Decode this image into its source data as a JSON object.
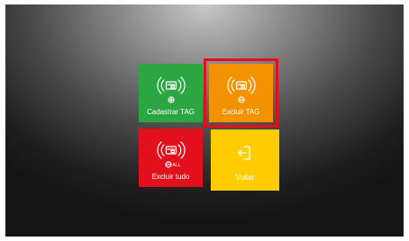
{
  "tiles": {
    "cadastrar": {
      "label": "Cadastrar TAG",
      "icon": "rfid-tag-add-icon",
      "color": "#2ca543"
    },
    "excluir": {
      "label": "Excluir TAG",
      "icon": "rfid-tag-remove-icon",
      "color": "#f39200",
      "selected": true
    },
    "excluir_tudo": {
      "label": "Excluir tudo",
      "icon": "rfid-tag-remove-all-icon",
      "badge": "ALL",
      "color": "#e2101c"
    },
    "voltar": {
      "label": "Voltar",
      "icon": "exit-icon",
      "color": "#ffcc00"
    }
  },
  "selection_color": "#e2101c"
}
